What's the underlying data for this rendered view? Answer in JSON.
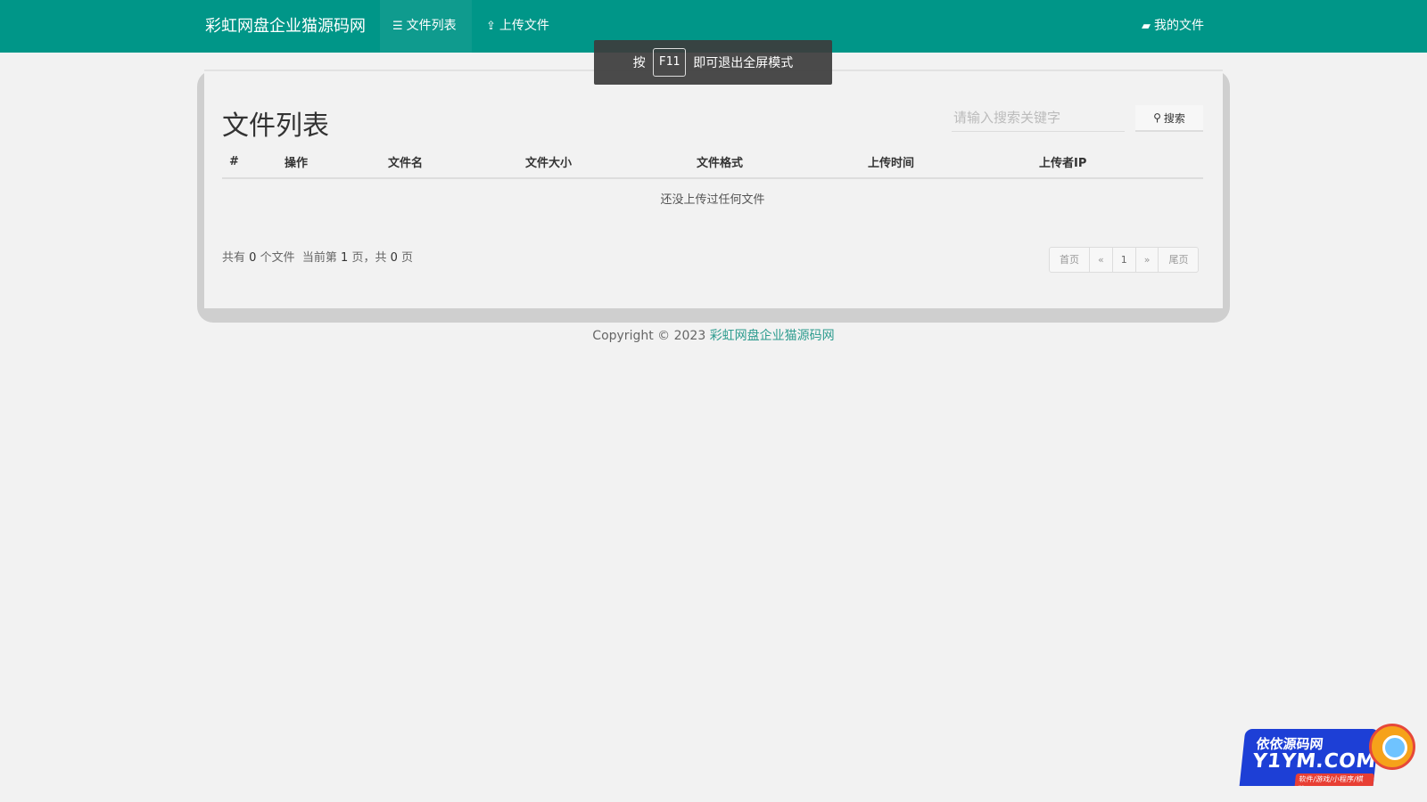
{
  "navbar": {
    "brand": "彩虹网盘企业猫源码网",
    "items": [
      {
        "label": "文件列表",
        "icon": "list-icon",
        "active": true
      },
      {
        "label": "上传文件",
        "icon": "upload-icon",
        "active": false
      }
    ],
    "right_item": {
      "label": "我的文件",
      "icon": "folder-open-icon"
    },
    "bg_color": "#009688"
  },
  "toast": {
    "prefix": "按",
    "key": "F11",
    "suffix": "即可退出全屏模式"
  },
  "main": {
    "title": "文件列表",
    "search": {
      "placeholder": "请输入搜索关键字",
      "value": "",
      "button_label": "搜索",
      "icon": "search-icon"
    },
    "table": {
      "columns": [
        "#",
        "操作",
        "文件名",
        "文件大小",
        "文件格式",
        "上传时间",
        "上传者IP"
      ],
      "rows": [],
      "empty_text": "还没上传过任何文件"
    },
    "summary": {
      "prefix": "共有",
      "file_count": "0",
      "files_unit": "个文件",
      "page_prefix": "当前第",
      "current_page": "1",
      "page_sep": "页，共",
      "total_pages": "0",
      "page_suffix": "页"
    },
    "pagination": {
      "first": "首页",
      "prev": "«",
      "page": "1",
      "next": "»",
      "last": "尾页"
    }
  },
  "footer": {
    "copyright": "Copyright © 2023",
    "link_text": "彩虹网盘企业猫源码网"
  },
  "watermark": {
    "line1": "依依源码网",
    "line2": "Y1YM.COM",
    "line3": "软件/游戏/小程序/棋牌"
  }
}
